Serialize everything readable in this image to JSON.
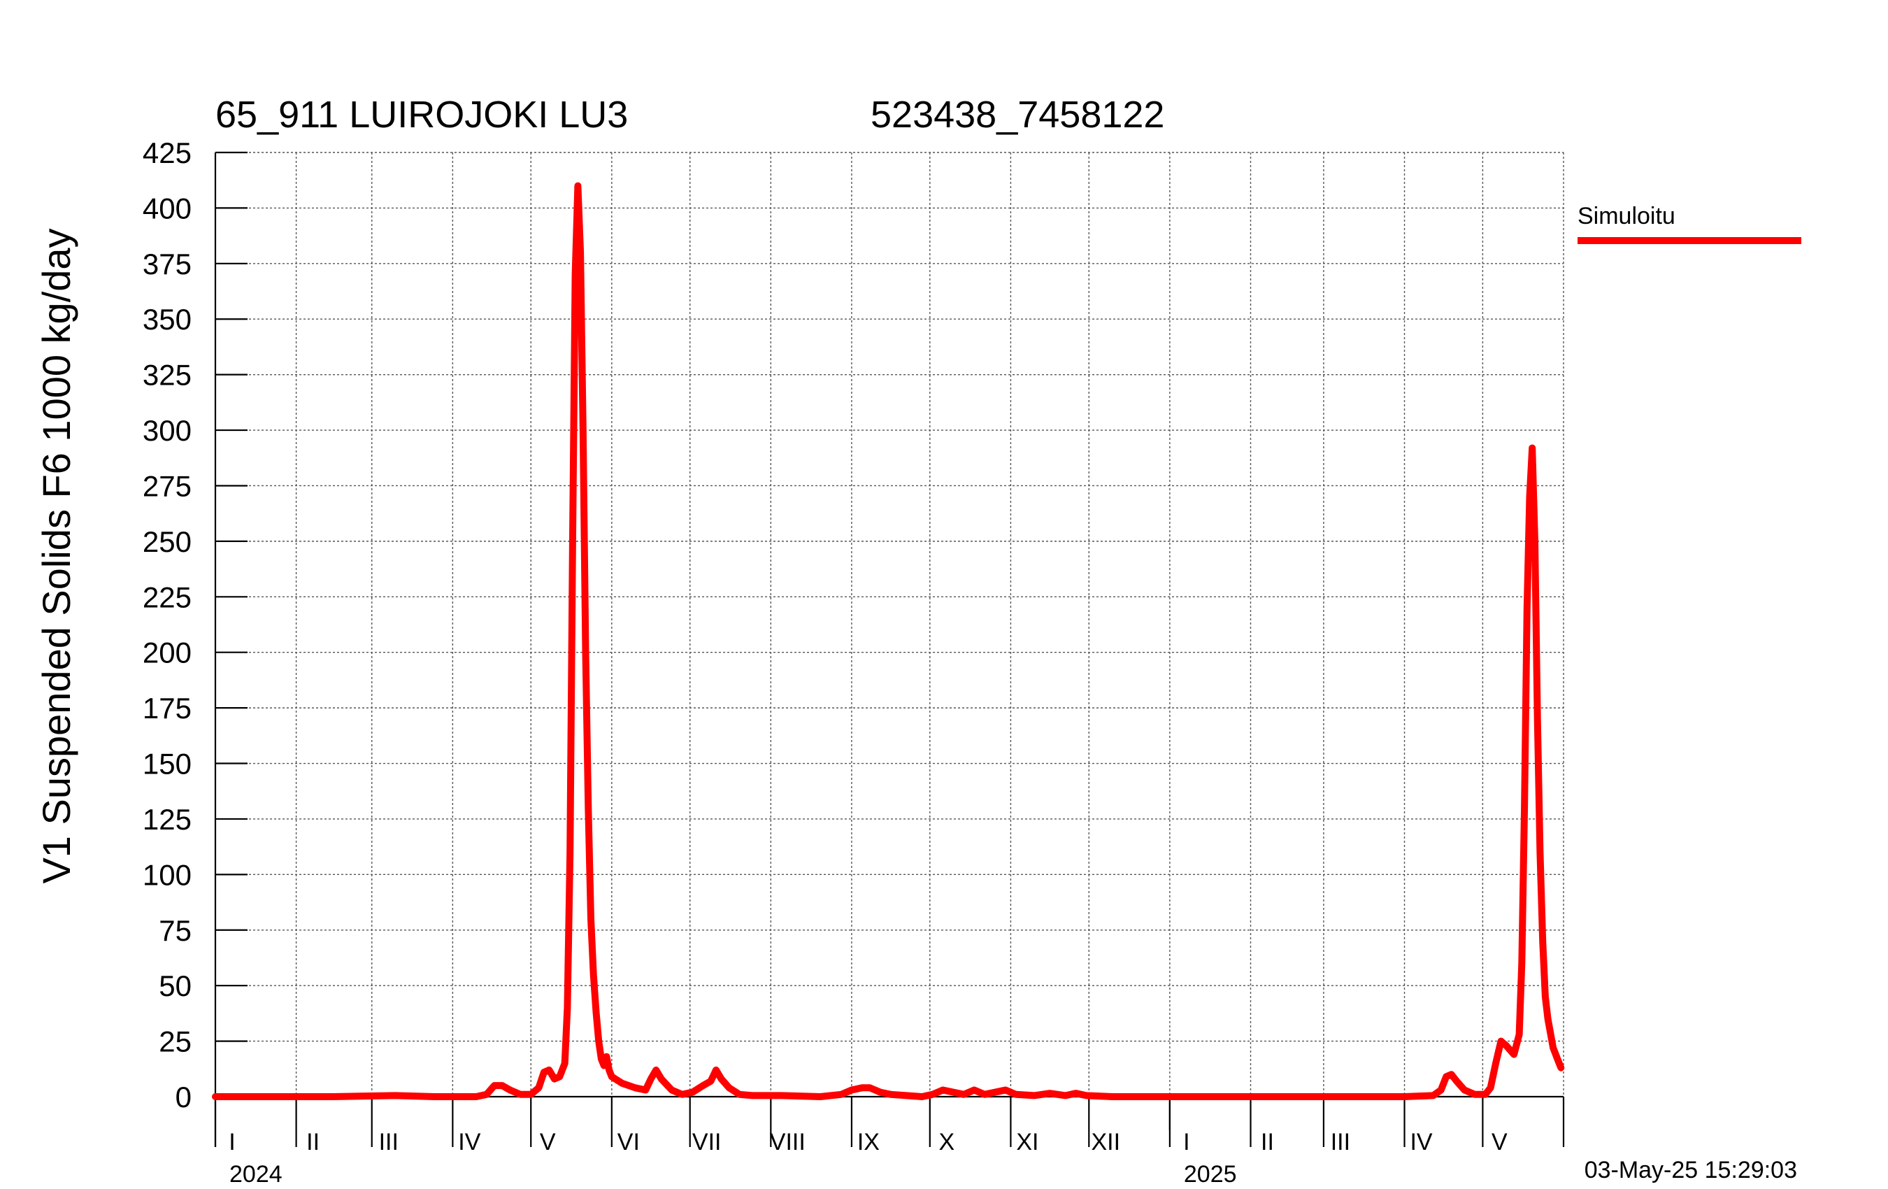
{
  "chart_data": {
    "type": "line",
    "title_left": "65_911 LUIROJOKI LU3",
    "title_right": "523438_7458122",
    "ylabel": "V1 Suspended Solids F6 1000 kg/day",
    "timestamp": "03-May-25 15:29:03",
    "ylim": [
      0,
      425
    ],
    "yticks": [
      0,
      25,
      50,
      75,
      100,
      125,
      150,
      175,
      200,
      225,
      250,
      275,
      300,
      325,
      350,
      375,
      400,
      425
    ],
    "xlim": [
      "2024-01-01",
      "2025-06-01"
    ],
    "month_labels": [
      "I",
      "II",
      "III",
      "IV",
      "V",
      "VI",
      "VII",
      "VIII",
      "IX",
      "X",
      "XI",
      "XII",
      "I",
      "II",
      "III",
      "IV",
      "V"
    ],
    "month_starts": [
      "2024-01-01",
      "2024-02-01",
      "2024-03-01",
      "2024-04-01",
      "2024-05-01",
      "2024-06-01",
      "2024-07-01",
      "2024-08-01",
      "2024-09-01",
      "2024-10-01",
      "2024-11-01",
      "2024-12-01",
      "2025-01-01",
      "2025-02-01",
      "2025-03-01",
      "2025-04-01",
      "2025-05-01"
    ],
    "year_labels": [
      {
        "label": "2024",
        "date": "2024-01-01"
      },
      {
        "label": "2025",
        "date": "2025-01-01"
      }
    ],
    "grid": true,
    "legend_position": "right",
    "series": [
      {
        "name": "Simuloitu",
        "color": "#ff0000",
        "points": [
          [
            "2024-01-01",
            0
          ],
          [
            "2024-02-15",
            0
          ],
          [
            "2024-03-10",
            0.5
          ],
          [
            "2024-03-25",
            0
          ],
          [
            "2024-04-10",
            0
          ],
          [
            "2024-04-14",
            1
          ],
          [
            "2024-04-17",
            5
          ],
          [
            "2024-04-20",
            5
          ],
          [
            "2024-04-23",
            3
          ],
          [
            "2024-04-27",
            1
          ],
          [
            "2024-05-01",
            1
          ],
          [
            "2024-05-04",
            4
          ],
          [
            "2024-05-06",
            11
          ],
          [
            "2024-05-08",
            12
          ],
          [
            "2024-05-10",
            8
          ],
          [
            "2024-05-12",
            9
          ],
          [
            "2024-05-14",
            15
          ],
          [
            "2024-05-15",
            40
          ],
          [
            "2024-05-16",
            110
          ],
          [
            "2024-05-17",
            250
          ],
          [
            "2024-05-18",
            370
          ],
          [
            "2024-05-19",
            410
          ],
          [
            "2024-05-20",
            380
          ],
          [
            "2024-05-21",
            300
          ],
          [
            "2024-05-22",
            200
          ],
          [
            "2024-05-23",
            130
          ],
          [
            "2024-05-24",
            80
          ],
          [
            "2024-05-25",
            55
          ],
          [
            "2024-05-26",
            38
          ],
          [
            "2024-05-27",
            25
          ],
          [
            "2024-05-28",
            17
          ],
          [
            "2024-05-29",
            14
          ],
          [
            "2024-05-30",
            18
          ],
          [
            "2024-05-31",
            12
          ],
          [
            "2024-06-01",
            9
          ],
          [
            "2024-06-05",
            6
          ],
          [
            "2024-06-10",
            4
          ],
          [
            "2024-06-14",
            3
          ],
          [
            "2024-06-16",
            8
          ],
          [
            "2024-06-18",
            12
          ],
          [
            "2024-06-20",
            8
          ],
          [
            "2024-06-24",
            3
          ],
          [
            "2024-06-28",
            1
          ],
          [
            "2024-07-02",
            2
          ],
          [
            "2024-07-06",
            5
          ],
          [
            "2024-07-09",
            7
          ],
          [
            "2024-07-11",
            12
          ],
          [
            "2024-07-13",
            8
          ],
          [
            "2024-07-16",
            4
          ],
          [
            "2024-07-20",
            1
          ],
          [
            "2024-07-25",
            0.5
          ],
          [
            "2024-08-05",
            0.5
          ],
          [
            "2024-08-20",
            0
          ],
          [
            "2024-08-28",
            1
          ],
          [
            "2024-09-01",
            3
          ],
          [
            "2024-09-05",
            4
          ],
          [
            "2024-09-08",
            4
          ],
          [
            "2024-09-12",
            2
          ],
          [
            "2024-09-16",
            1
          ],
          [
            "2024-09-22",
            0.5
          ],
          [
            "2024-09-28",
            0
          ],
          [
            "2024-10-02",
            1
          ],
          [
            "2024-10-06",
            3
          ],
          [
            "2024-10-10",
            2
          ],
          [
            "2024-10-14",
            1
          ],
          [
            "2024-10-18",
            3
          ],
          [
            "2024-10-22",
            1
          ],
          [
            "2024-10-26",
            2
          ],
          [
            "2024-10-30",
            3
          ],
          [
            "2024-11-03",
            1
          ],
          [
            "2024-11-10",
            0.5
          ],
          [
            "2024-11-16",
            1.5
          ],
          [
            "2024-11-22",
            0.5
          ],
          [
            "2024-11-26",
            1.5
          ],
          [
            "2024-11-30",
            0.5
          ],
          [
            "2024-12-10",
            0
          ],
          [
            "2025-01-15",
            0
          ],
          [
            "2025-02-15",
            0
          ],
          [
            "2025-03-15",
            0
          ],
          [
            "2025-04-01",
            0
          ],
          [
            "2025-04-12",
            0.5
          ],
          [
            "2025-04-15",
            3
          ],
          [
            "2025-04-17",
            9
          ],
          [
            "2025-04-19",
            10
          ],
          [
            "2025-04-21",
            7
          ],
          [
            "2025-04-24",
            3
          ],
          [
            "2025-04-28",
            1
          ],
          [
            "2025-05-02",
            1
          ],
          [
            "2025-05-04",
            4
          ],
          [
            "2025-05-06",
            15
          ],
          [
            "2025-05-08",
            25
          ],
          [
            "2025-05-10",
            23
          ],
          [
            "2025-05-13",
            19
          ],
          [
            "2025-05-15",
            28
          ],
          [
            "2025-05-16",
            60
          ],
          [
            "2025-05-17",
            130
          ],
          [
            "2025-05-18",
            220
          ],
          [
            "2025-05-19",
            270
          ],
          [
            "2025-05-20",
            292
          ],
          [
            "2025-05-21",
            250
          ],
          [
            "2025-05-22",
            170
          ],
          [
            "2025-05-23",
            110
          ],
          [
            "2025-05-24",
            70
          ],
          [
            "2025-05-25",
            45
          ],
          [
            "2025-05-26",
            35
          ],
          [
            "2025-05-28",
            22
          ],
          [
            "2025-05-30",
            16
          ],
          [
            "2025-05-31",
            13
          ]
        ]
      }
    ]
  }
}
